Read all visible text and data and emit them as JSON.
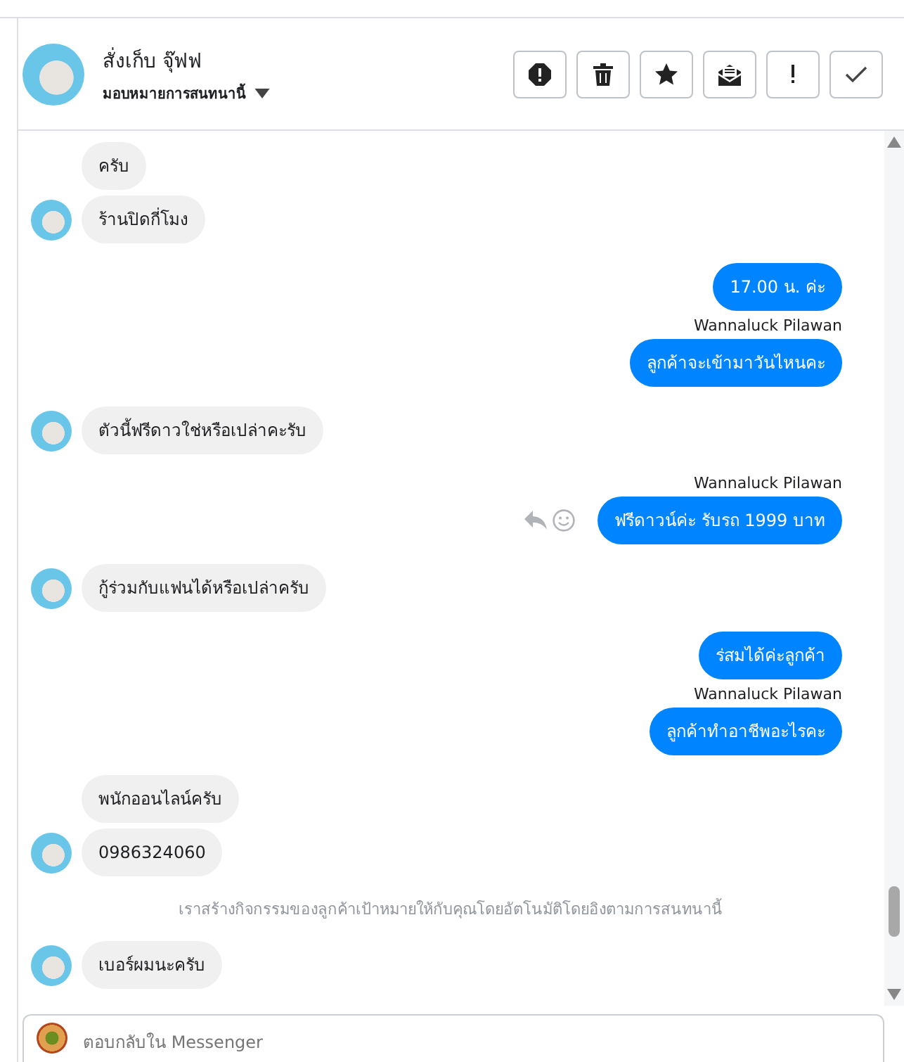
{
  "header": {
    "name": "สั่งเก็บ จุ๊ฟฟ",
    "assign_label": "มอบหมายการสนทนานี้"
  },
  "messages": [
    {
      "kind": "in",
      "text": "ครับ",
      "avatar": false
    },
    {
      "kind": "in",
      "text": "ร้านปิดกี่โมง",
      "avatar": true
    },
    {
      "kind": "out",
      "text": "17.00 น.  ค่ะ",
      "actions": false
    },
    {
      "kind": "sender",
      "text": "Wannaluck Pilawan"
    },
    {
      "kind": "out",
      "text": "ลูกค้าจะเข้ามาวันไหนคะ",
      "actions": false
    },
    {
      "kind": "in",
      "text": "ตัวนี้ฟรีดาวใช่หรือเปล่าคะรับ",
      "avatar": true
    },
    {
      "kind": "sender",
      "text": "Wannaluck Pilawan"
    },
    {
      "kind": "out",
      "text": "ฟรีดาวน์ค่ะ  รับรถ 1999 บาท",
      "actions": true
    },
    {
      "kind": "in",
      "text": "กู้ร่วมกับแฟนได้หรือเปล่าครับ",
      "avatar": true
    },
    {
      "kind": "out",
      "text": "ร่สมได้ค่ะลูกค้า",
      "actions": false
    },
    {
      "kind": "sender",
      "text": "Wannaluck Pilawan"
    },
    {
      "kind": "out",
      "text": "ลูกค้าทำอาชีพอะไรคะ",
      "actions": false
    },
    {
      "kind": "in",
      "text": "พนักออนไลน์ครับ",
      "avatar": false
    },
    {
      "kind": "in",
      "text": "0986324060",
      "avatar": true
    },
    {
      "kind": "notice",
      "text": "เราสร้างกิจกรรมของลูกค้าเป้าหมายให้กับคุณโดยอัตโนมัติโดยอิงตามการสนทนานี้"
    },
    {
      "kind": "in",
      "text": "เบอร์ผมนะครับ",
      "avatar": true
    }
  ],
  "composer": {
    "placeholder": "ตอบกลับใน Messenger"
  }
}
